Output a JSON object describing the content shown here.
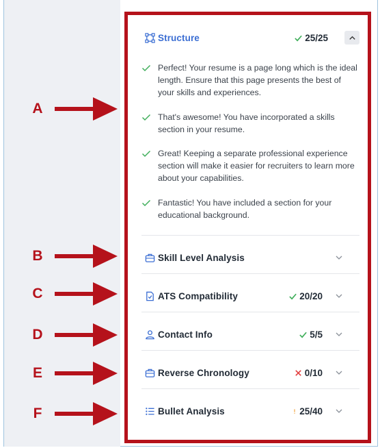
{
  "annotations": [
    "A",
    "B",
    "C",
    "D",
    "E",
    "F"
  ],
  "colors": {
    "annotation_red": "#b5121b",
    "accent_blue": "#3b6ed3",
    "success_green": "#3fae5a",
    "error_red": "#e24040",
    "warning_orange": "#f2a33a"
  },
  "sections": [
    {
      "title": "Structure",
      "icon": "structure-icon",
      "score": "25/25",
      "status": "success",
      "expanded": true,
      "items": [
        "Perfect! Your resume is a page long which is the ideal length. Ensure that this page presents the best of your skills and experiences.",
        "That's awesome! You have incorporated a skills section in your resume.",
        "Great! Keeping a separate professional experience section will make it easier for recruiters to learn more about your capabilities.",
        "Fantastic! You have included a section for your educational background."
      ]
    },
    {
      "title": "Skill Level Analysis",
      "icon": "briefcase-icon",
      "score": "",
      "status": "none"
    },
    {
      "title": "ATS Compatibility",
      "icon": "document-check-icon",
      "score": "20/20",
      "status": "success"
    },
    {
      "title": "Contact Info",
      "icon": "user-icon",
      "score": "5/5",
      "status": "success"
    },
    {
      "title": "Reverse Chronology",
      "icon": "briefcase-icon",
      "score": "0/10",
      "status": "error"
    },
    {
      "title": "Bullet Analysis",
      "icon": "list-icon",
      "score": "25/40",
      "status": "warning"
    }
  ]
}
